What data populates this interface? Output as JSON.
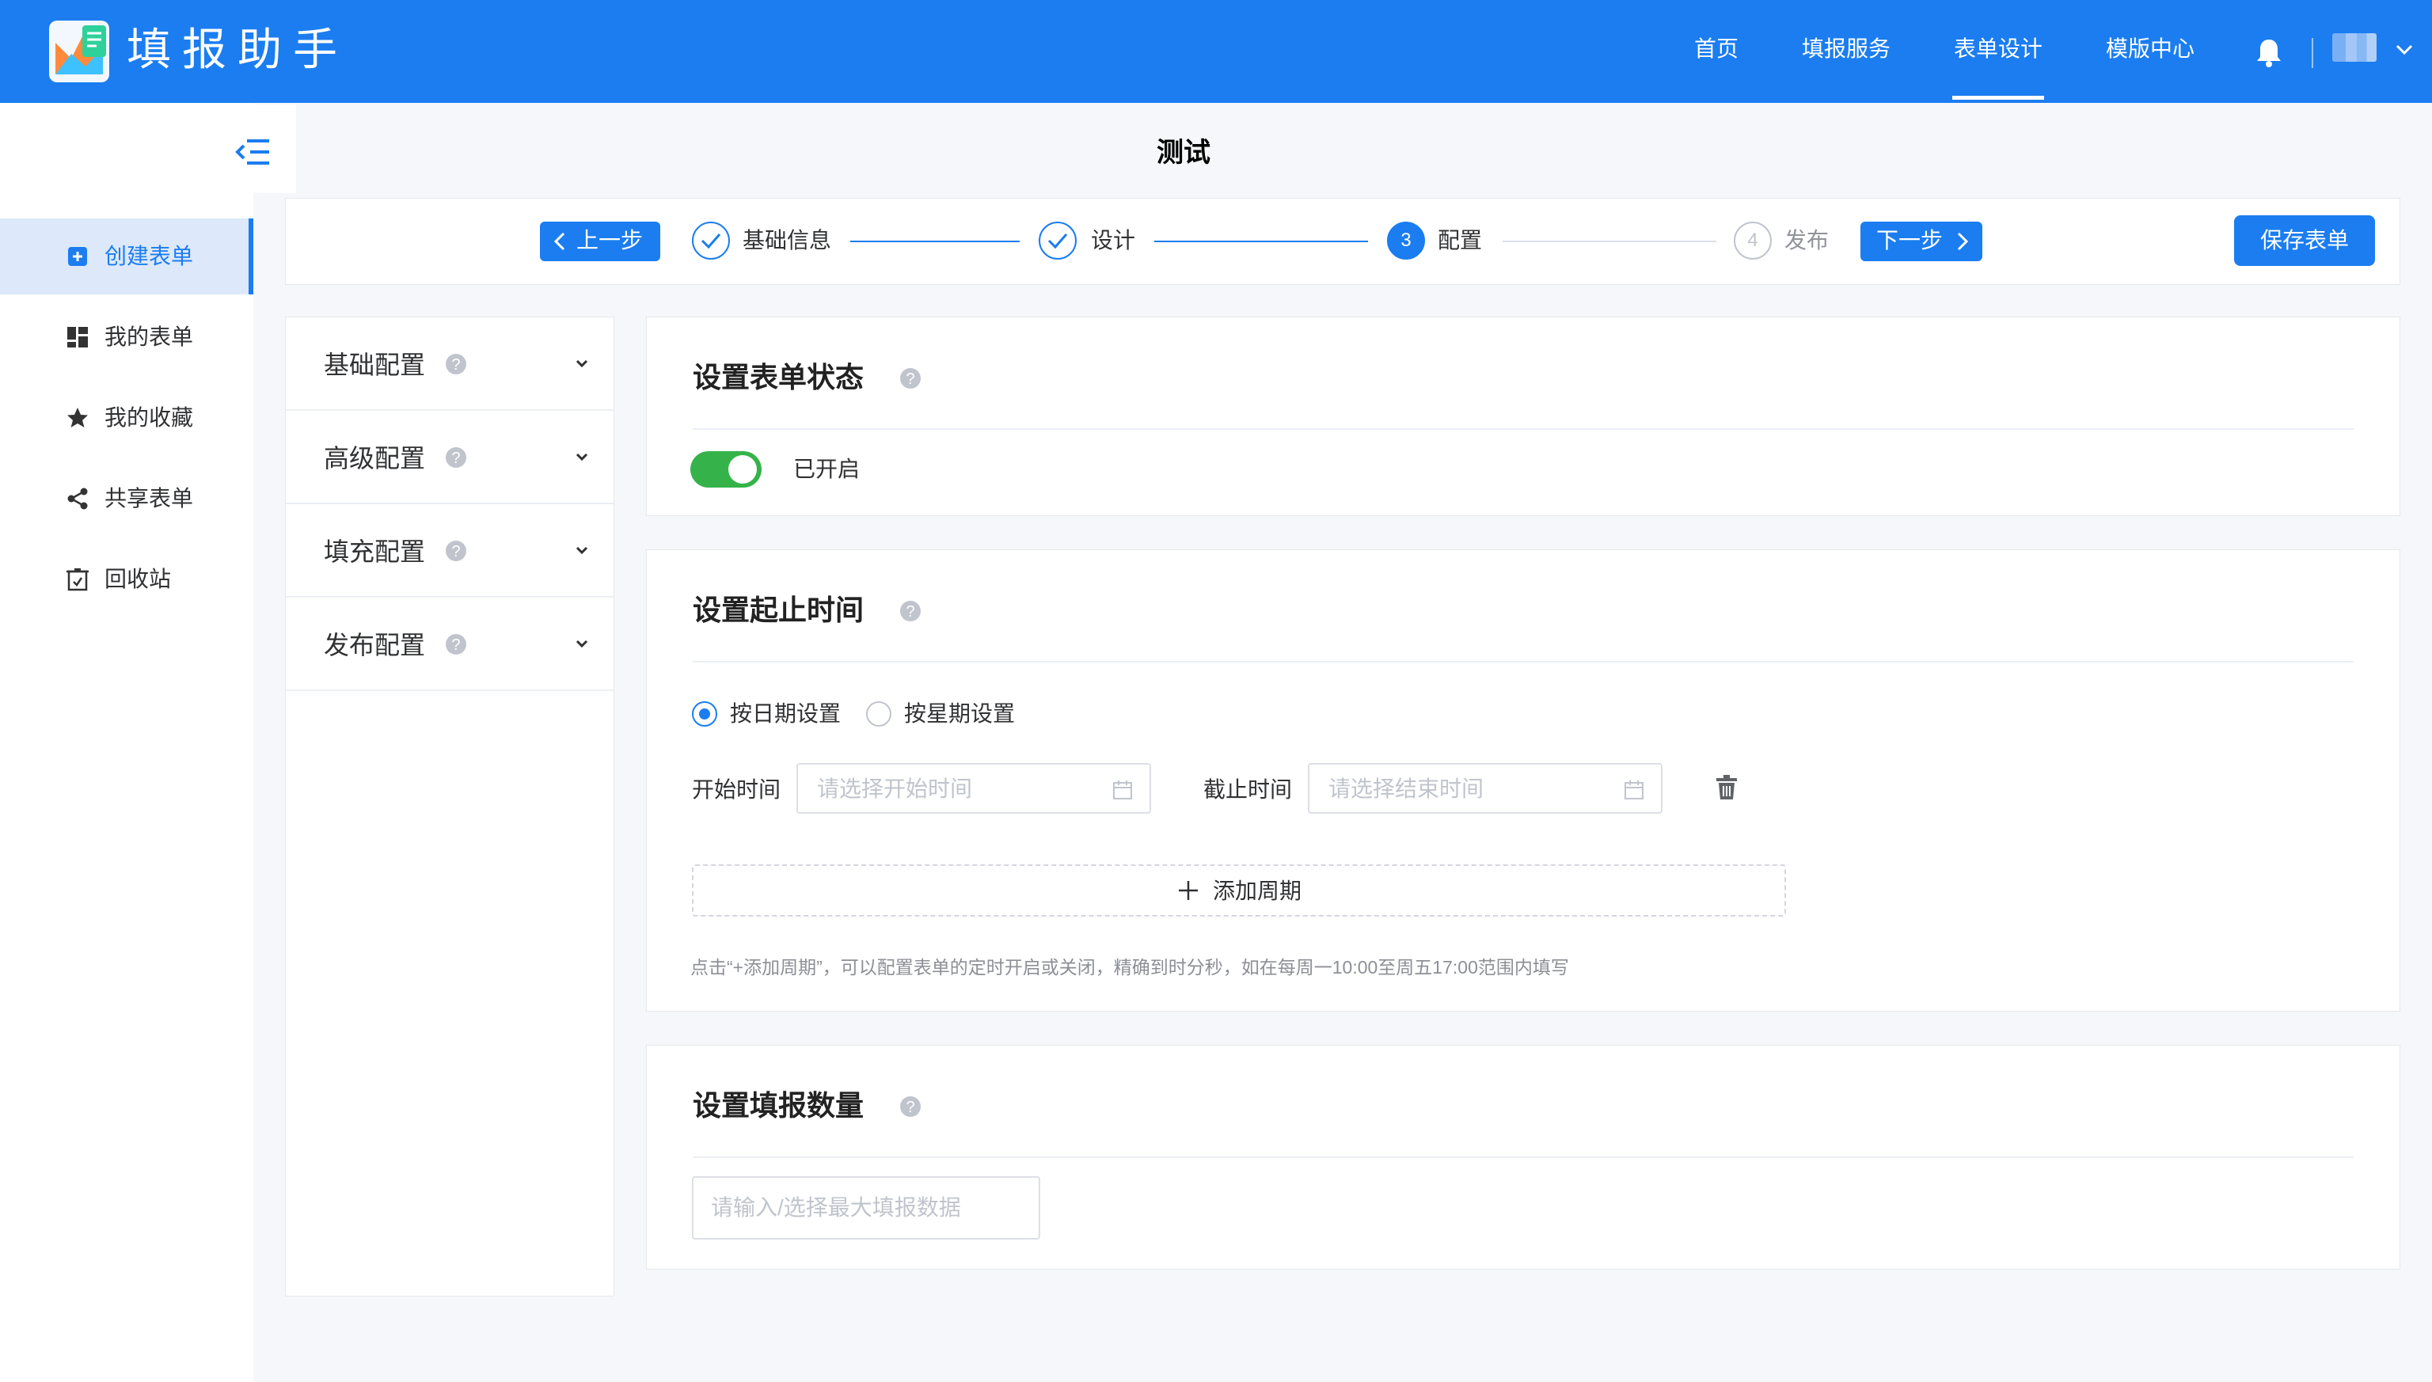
{
  "app": {
    "brand": "填报助手"
  },
  "header": {
    "nav": [
      "首页",
      "填报服务",
      "表单设计",
      "模版中心"
    ],
    "active_nav": "表单设计"
  },
  "sidebar": {
    "items": [
      {
        "label": "创建表单",
        "icon": "plus-square-icon",
        "active": true
      },
      {
        "label": "我的表单",
        "icon": "grid-icon",
        "active": false
      },
      {
        "label": "我的收藏",
        "icon": "star-icon",
        "active": false
      },
      {
        "label": "共享表单",
        "icon": "share-icon",
        "active": false
      },
      {
        "label": "回收站",
        "icon": "recycle-bin-icon",
        "active": false
      }
    ]
  },
  "page": {
    "title": "测试"
  },
  "steps": {
    "prev_label": "上一步",
    "next_label": "下一步",
    "save_label": "保存表单",
    "items": [
      {
        "label": "基础信息",
        "status": "done"
      },
      {
        "label": "设计",
        "status": "done"
      },
      {
        "label": "配置",
        "status": "current",
        "number": "3"
      },
      {
        "label": "发布",
        "status": "todo",
        "number": "4"
      }
    ]
  },
  "config_menu": {
    "items": [
      "基础配置",
      "高级配置",
      "填充配置",
      "发布配置"
    ]
  },
  "status_card": {
    "title": "设置表单状态",
    "toggle_on": true,
    "toggle_label": "已开启"
  },
  "time_card": {
    "title": "设置起止时间",
    "radio_date": "按日期设置",
    "radio_week": "按星期设置",
    "selected": "按日期设置",
    "start_label": "开始时间",
    "start_placeholder": "请选择开始时间",
    "end_label": "截止时间",
    "end_placeholder": "请选择结束时间",
    "add_period_label": "添加周期",
    "hint": "点击“+添加周期”，可以配置表单的定时开启或关闭，精确到时分秒，如在每周一10:00至周五17:00范围内填写"
  },
  "quantity_card": {
    "title": "设置填报数量",
    "placeholder": "请输入/选择最大填报数据"
  },
  "colors": {
    "primary": "#1b7df0",
    "toggle_on": "#35b34a",
    "background": "#f5f7fa"
  }
}
